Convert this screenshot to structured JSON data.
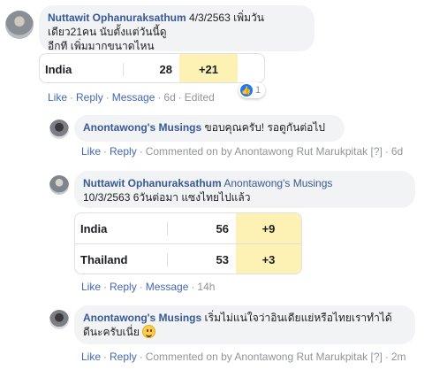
{
  "comment1": {
    "author": "Nuttawit Ophanuraksathum",
    "text_line1": "4/3/2563 เพิ่มวันเดียว21คน นับตั้งแต่วันนี้ดู",
    "text_line2": "อีกที เพิ่มมากขนาดไหน",
    "table": {
      "country": "India",
      "count": "28",
      "delta": "+21"
    },
    "actions": {
      "like": "Like",
      "reply": "Reply",
      "message": "Message",
      "time": "6d",
      "edited": "Edited"
    },
    "reaction_count": "1"
  },
  "reply1": {
    "author": "Anontawong's Musings",
    "text": "ขอบคุณครับ! รอดูกันต่อไป",
    "actions": {
      "like": "Like",
      "reply": "Reply",
      "commented_on_by": "Commented on by Anontawong Rut Marukpitak",
      "help": "[?]",
      "time": "6d"
    }
  },
  "reply2": {
    "author": "Nuttawit Ophanuraksathum",
    "tag": "Anontawong's Musings",
    "text": "10/3/2563 6วันต่อมา แซงไทยไปแล้ว",
    "table": [
      {
        "country": "India",
        "count": "56",
        "delta": "+9"
      },
      {
        "country": "Thailand",
        "count": "53",
        "delta": "+3"
      }
    ],
    "actions": {
      "like": "Like",
      "reply": "Reply",
      "message": "Message",
      "time": "14h"
    }
  },
  "reply3": {
    "author": "Anontawong's Musings",
    "text_line1": "เริ่มไม่แน่ใจว่าอินเดียแย่หรือไทยเราทำได้",
    "text_line2": "ดีนะครับเนี่ย",
    "actions": {
      "like": "Like",
      "reply": "Reply",
      "commented_on_by": "Commented on by Anontawong Rut Marukpitak",
      "help": "[?]",
      "time": "2m"
    }
  }
}
